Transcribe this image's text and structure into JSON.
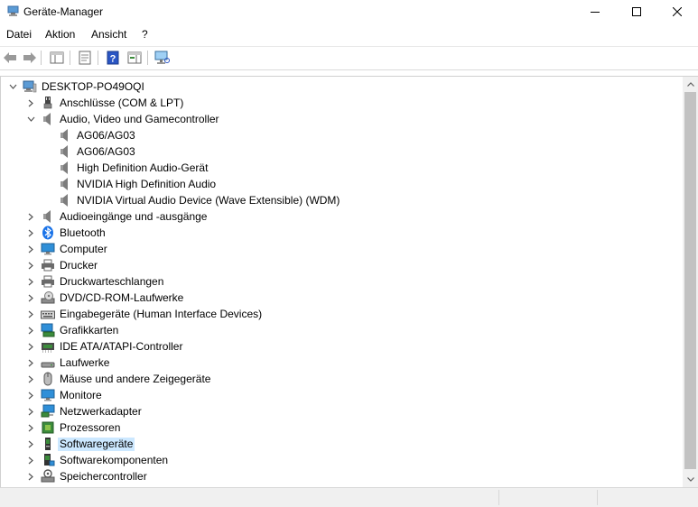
{
  "window": {
    "title": "Geräte-Manager",
    "icons": {
      "app": "device-manager-icon",
      "minimize": "minimize-icon",
      "maximize": "maximize-icon",
      "close": "close-icon"
    }
  },
  "menu": {
    "items": [
      "Datei",
      "Aktion",
      "Ansicht",
      "?"
    ]
  },
  "toolbar": {
    "buttons": [
      "back-arrow-icon",
      "forward-arrow-icon",
      "show-hide-console-tree-icon",
      "properties-icon",
      "help-icon",
      "action-pane-icon",
      "scan-hardware-icon"
    ]
  },
  "tree": {
    "root": "DESKTOP-PO49OQI",
    "rows": [
      {
        "label": "Anschlüsse (COM & LPT)",
        "icon": "port-icon",
        "expanded": false
      },
      {
        "label": "Audio, Video und Gamecontroller",
        "icon": "speaker-icon",
        "expanded": true
      },
      {
        "label": "AG06/AG03",
        "icon": "speaker-icon",
        "child": true
      },
      {
        "label": "AG06/AG03",
        "icon": "speaker-icon",
        "child": true
      },
      {
        "label": "High Definition Audio-Gerät",
        "icon": "speaker-icon",
        "child": true
      },
      {
        "label": "NVIDIA High Definition Audio",
        "icon": "speaker-icon",
        "child": true
      },
      {
        "label": "NVIDIA Virtual Audio Device (Wave Extensible) (WDM)",
        "icon": "speaker-icon",
        "child": true
      },
      {
        "label": "Audioeingänge und -ausgänge",
        "icon": "speaker-icon",
        "expanded": false
      },
      {
        "label": "Bluetooth",
        "icon": "bluetooth-icon",
        "expanded": false
      },
      {
        "label": "Computer",
        "icon": "monitor-icon",
        "expanded": false
      },
      {
        "label": "Drucker",
        "icon": "printer-icon",
        "expanded": false
      },
      {
        "label": "Druckwarteschlangen",
        "icon": "printer-icon",
        "expanded": false
      },
      {
        "label": "DVD/CD-ROM-Laufwerke",
        "icon": "disc-drive-icon",
        "expanded": false
      },
      {
        "label": "Eingabegeräte (Human Interface Devices)",
        "icon": "keyboard-icon",
        "expanded": false
      },
      {
        "label": "Grafikkarten",
        "icon": "display-adapter-icon",
        "expanded": false
      },
      {
        "label": "IDE ATA/ATAPI-Controller",
        "icon": "ide-controller-icon",
        "expanded": false
      },
      {
        "label": "Laufwerke",
        "icon": "drive-icon",
        "expanded": false
      },
      {
        "label": "Mäuse und andere Zeigegeräte",
        "icon": "mouse-icon",
        "expanded": false
      },
      {
        "label": "Monitore",
        "icon": "monitor-icon",
        "expanded": false
      },
      {
        "label": "Netzwerkadapter",
        "icon": "network-adapter-icon",
        "expanded": false
      },
      {
        "label": "Prozessoren",
        "icon": "processor-icon",
        "expanded": false
      },
      {
        "label": "Softwaregeräte",
        "icon": "software-device-icon",
        "expanded": false,
        "selected": true
      },
      {
        "label": "Softwarekomponenten",
        "icon": "software-component-icon",
        "expanded": false
      },
      {
        "label": "Speichercontroller",
        "icon": "storage-controller-icon",
        "expanded": false
      }
    ]
  },
  "colors": {
    "selection": "#cce8ff",
    "help_blue": "#2a55c4",
    "bluetooth_blue": "#1a73e8",
    "monitor_blue": "#2f8fd8"
  }
}
